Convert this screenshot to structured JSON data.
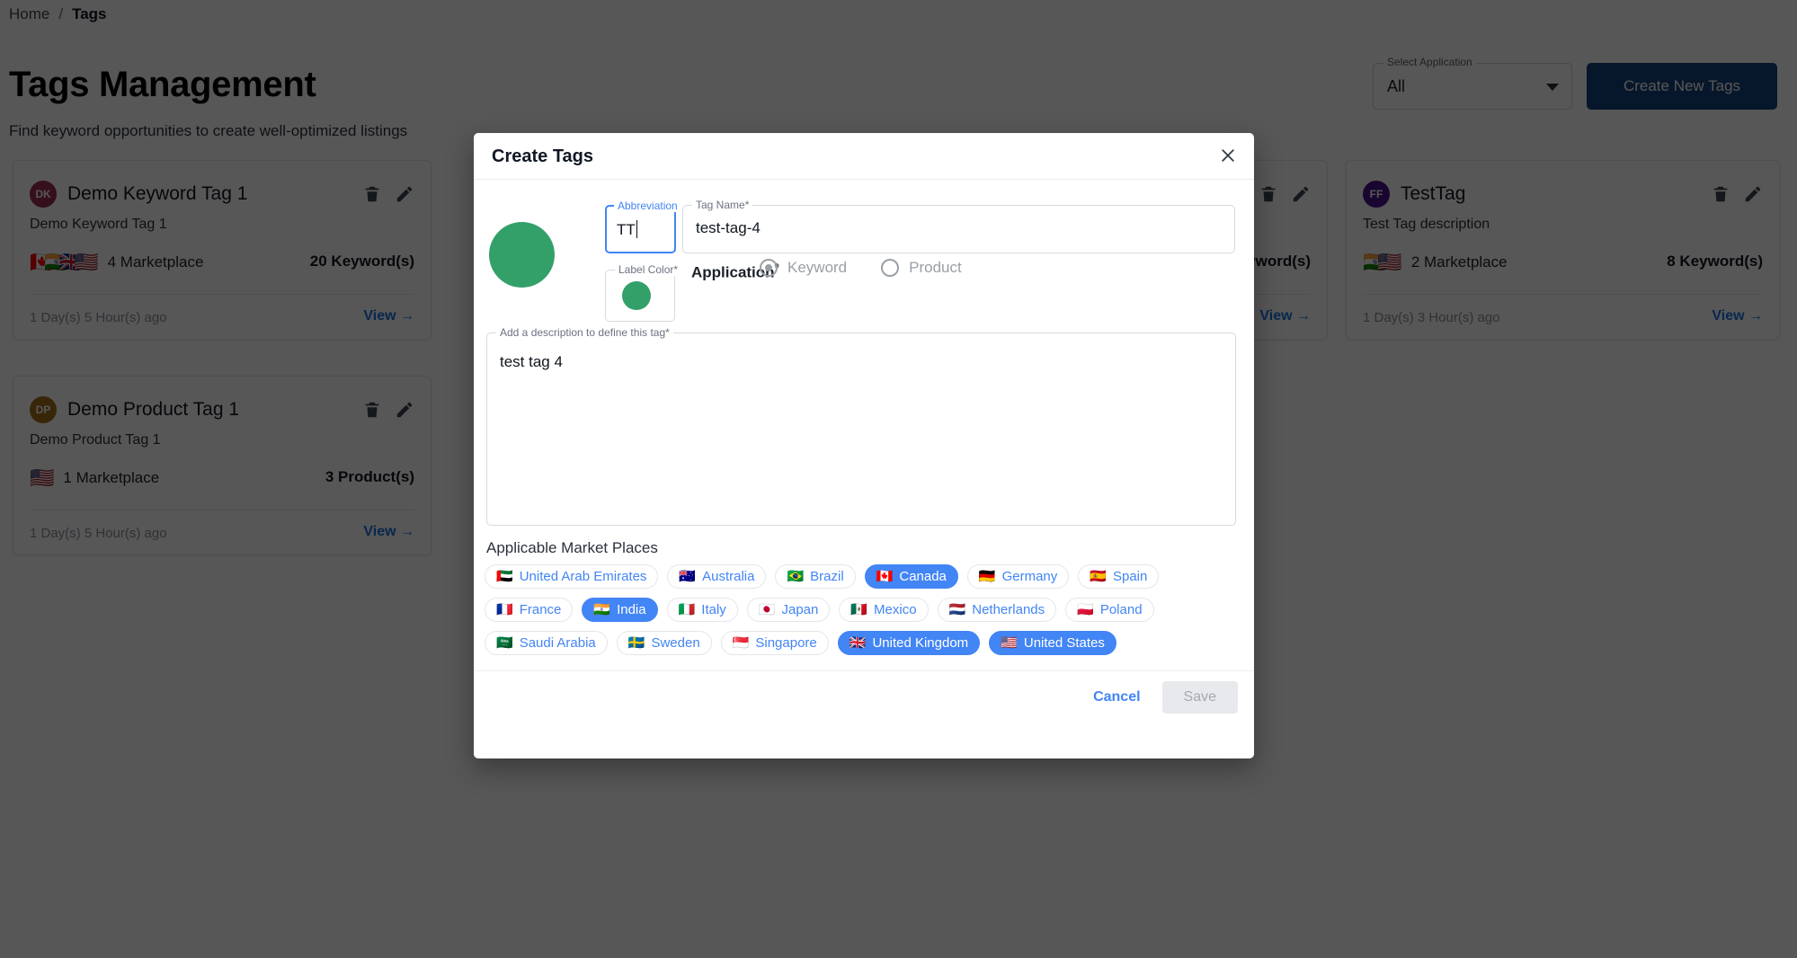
{
  "breadcrumb": {
    "home": "Home",
    "separator": "/",
    "current": "Tags"
  },
  "header": {
    "title": "Tags Management",
    "subtitle": "Find keyword opportunities to create well-optimized listings",
    "select_application_label": "Select Application",
    "select_application_value": "All",
    "create_button": "Create New Tags"
  },
  "cards": [
    {
      "initials": "DK",
      "avatar_color": "#9c2c53",
      "title": "Demo Keyword Tag 1",
      "description": "Demo Keyword Tag 1",
      "flags": [
        "🇨🇦",
        "🇮🇳",
        "🇬🇧",
        "🇺🇸"
      ],
      "marketplace": "4 Marketplace",
      "count": "20 Keyword(s)",
      "time": "1 Day(s) 5 Hour(s) ago",
      "view": "View →"
    },
    {
      "initials": "DP",
      "avatar_color": "#a1701a",
      "title": "Demo Product Tag 1",
      "description": "Demo Product Tag 1",
      "flags": [
        "🇺🇸"
      ],
      "marketplace": "1 Marketplace",
      "count": "3 Product(s)",
      "time": "1 Day(s) 5 Hour(s) ago",
      "view": "View →"
    },
    {
      "initials": "FF",
      "avatar_color": "#4a148c",
      "title": "TestTag",
      "description": "Test Tag description",
      "flags": [
        "🇮🇳",
        "🇺🇸"
      ],
      "marketplace": "2 Marketplace",
      "count": "8 Keyword(s)",
      "time": "1 Day(s) 3 Hour(s) ago",
      "view": "View →"
    }
  ],
  "modal": {
    "title": "Create Tags",
    "close_icon": "close-icon",
    "preview_color": "#33a06a",
    "abbreviation": {
      "label": "Abbreviation",
      "value": "TT"
    },
    "tag_name": {
      "label": "Tag Name*",
      "value": "test-tag-4"
    },
    "label_color": {
      "label": "Label Color*",
      "value": "#33a06a"
    },
    "application": {
      "label": "Application",
      "required_mark": "*",
      "options": [
        {
          "label": "Keyword",
          "selected": true
        },
        {
          "label": "Product",
          "selected": false
        }
      ]
    },
    "description": {
      "label": "Add a description to define this tag*",
      "value": "test tag 4"
    },
    "marketplaces_title": "Applicable Market Places",
    "marketplaces": [
      {
        "name": "United Arab Emirates",
        "flag": "🇦🇪",
        "selected": false
      },
      {
        "name": "Australia",
        "flag": "🇦🇺",
        "selected": false
      },
      {
        "name": "Brazil",
        "flag": "🇧🇷",
        "selected": false
      },
      {
        "name": "Canada",
        "flag": "🇨🇦",
        "selected": true
      },
      {
        "name": "Germany",
        "flag": "🇩🇪",
        "selected": false
      },
      {
        "name": "Spain",
        "flag": "🇪🇸",
        "selected": false
      },
      {
        "name": "France",
        "flag": "🇫🇷",
        "selected": false
      },
      {
        "name": "India",
        "flag": "🇮🇳",
        "selected": true
      },
      {
        "name": "Italy",
        "flag": "🇮🇹",
        "selected": false
      },
      {
        "name": "Japan",
        "flag": "🇯🇵",
        "selected": false
      },
      {
        "name": "Mexico",
        "flag": "🇲🇽",
        "selected": false
      },
      {
        "name": "Netherlands",
        "flag": "🇳🇱",
        "selected": false
      },
      {
        "name": "Poland",
        "flag": "🇵🇱",
        "selected": false
      },
      {
        "name": "Saudi Arabia",
        "flag": "🇸🇦",
        "selected": false
      },
      {
        "name": "Sweden",
        "flag": "🇸🇪",
        "selected": false
      },
      {
        "name": "Singapore",
        "flag": "🇸🇬",
        "selected": false
      },
      {
        "name": "United Kingdom",
        "flag": "🇬🇧",
        "selected": true
      },
      {
        "name": "United States",
        "flag": "🇺🇸",
        "selected": true
      }
    ],
    "cancel_button": "Cancel",
    "save_button": "Save"
  },
  "colors": {
    "accent_blue": "#4285f4",
    "primary_dark_blue": "#16447e",
    "tag_green": "#33a06a",
    "link_blue": "#1a73e8"
  }
}
